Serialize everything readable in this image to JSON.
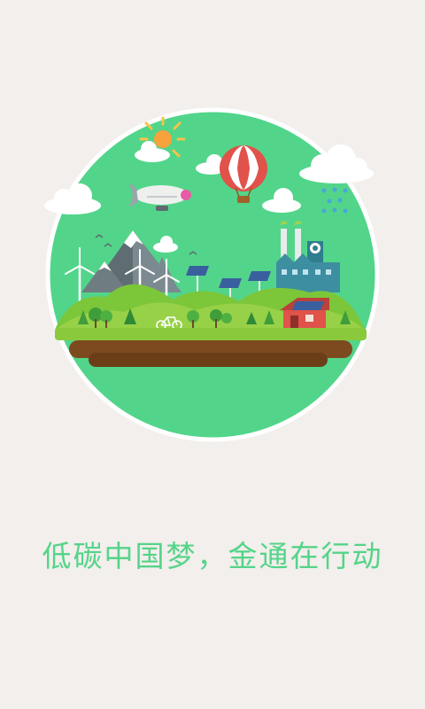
{
  "splash": {
    "slogan": "低碳中国梦，金通在行动"
  },
  "colors": {
    "background": "#f2efec",
    "circle": "#52d58a",
    "slogan": "#55d489",
    "grass": "#8bc93c",
    "soil": "#7d4a1f",
    "sun": "#f7a23a",
    "balloon": "#e0524a",
    "factory": "#3d8ea1"
  },
  "icons": [
    "sun-icon",
    "cloud-icon",
    "hot-air-balloon-icon",
    "airship-icon",
    "rain-icon",
    "mountain-icon",
    "wind-turbine-icon",
    "solar-panel-icon",
    "factory-icon",
    "house-icon",
    "bicycle-icon",
    "tree-icon",
    "bird-icon"
  ]
}
